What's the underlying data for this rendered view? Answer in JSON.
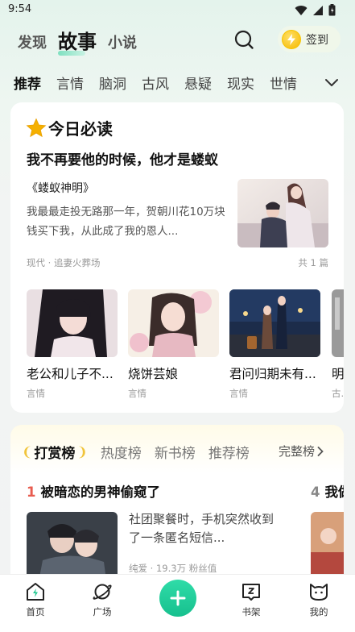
{
  "status_bar": {
    "time": "9:54"
  },
  "top_tabs": [
    {
      "label": "发现",
      "active": false
    },
    {
      "label": "故事",
      "active": true
    },
    {
      "label": "小说",
      "active": false
    }
  ],
  "checkin": {
    "label": "签到"
  },
  "categories": [
    "推荐",
    "言情",
    "脑洞",
    "古风",
    "悬疑",
    "现实",
    "世情"
  ],
  "reading_card": {
    "title": "今日必读",
    "headline": "我不再要他的时候，他才是蝼蚁",
    "book_title": "《蝼蚁神明》",
    "description": "我最最走投无路那一年，贺朝川花10万块钱买下我，从此成了我的恩人...",
    "meta": "现代 · 追妻火葬场",
    "count": "共 1 篇",
    "books": [
      {
        "title": "老公和儿子不...",
        "tag": "言情"
      },
      {
        "title": "烧饼芸娘",
        "tag": "言情"
      },
      {
        "title": "君问归期未有...",
        "tag": "言情"
      },
      {
        "title": "明",
        "tag": "古..."
      }
    ]
  },
  "rank_card": {
    "tabs": [
      "打赏榜",
      "热度榜",
      "新书榜",
      "推荐榜"
    ],
    "more_label": "完整榜",
    "item1": {
      "rank": "1",
      "title": "被暗恋的男神偷窥了",
      "description": "社团聚餐时，手机突然收到了一条匿名短信...",
      "meta": "纯爱 · 19.3万 粉丝值"
    },
    "item2": {
      "rank": "4",
      "title": "我做"
    }
  },
  "bottom_nav": [
    {
      "label": "首页"
    },
    {
      "label": "广场"
    },
    {
      "label": "书架"
    },
    {
      "label": "我的"
    }
  ],
  "colors": {
    "accent": "#17c08e",
    "rank_red": "#e85c4f",
    "star": "#f5b000"
  }
}
